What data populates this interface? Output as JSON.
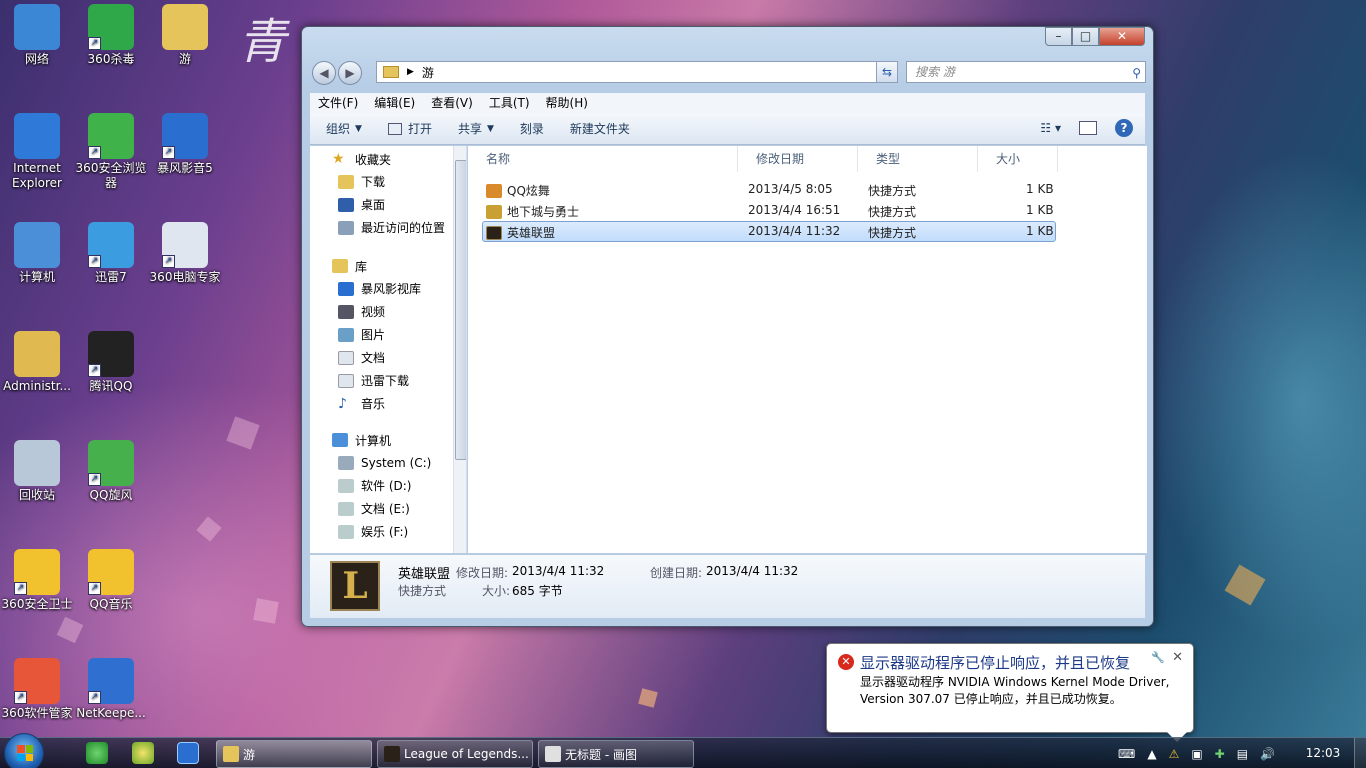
{
  "wallpaper": {
    "calligraphy": "青"
  },
  "desktop_icons": [
    {
      "label": "网络",
      "color": "#3b87d6"
    },
    {
      "label": "360杀毒",
      "color": "#2fa84a"
    },
    {
      "label": "游",
      "color": "#e6c45c"
    },
    {
      "label": "Internet Explorer",
      "color": "#2f7ad8"
    },
    {
      "label": "360安全浏览器",
      "color": "#3fb34a"
    },
    {
      "label": "暴风影音5",
      "color": "#2a6fd0"
    },
    {
      "label": "计算机",
      "color": "#4b8fd8"
    },
    {
      "label": "迅雷7",
      "color": "#3b9ce0"
    },
    {
      "label": "360电脑专家",
      "color": "#e0e6ef"
    },
    {
      "label": "Administr...",
      "color": "#e0b950"
    },
    {
      "label": "腾讯QQ",
      "color": "#222222"
    },
    {
      "label": "回收站",
      "color": "#b9c8d8"
    },
    {
      "label": "QQ旋风",
      "color": "#45b04c"
    },
    {
      "label": "360安全卫士",
      "color": "#f2c12e"
    },
    {
      "label": "QQ音乐",
      "color": "#f2c12e"
    },
    {
      "label": "360软件管家",
      "color": "#e8563a"
    },
    {
      "label": "NetKeepe...",
      "color": "#2f6fd0"
    }
  ],
  "window": {
    "caption_min": "–",
    "caption_max": "□",
    "caption_close": "✕",
    "back": "◀",
    "forward": "▶",
    "address": "游",
    "search_placeholder": "搜索 游",
    "menu": [
      "文件(F)",
      "编辑(E)",
      "查看(V)",
      "工具(T)",
      "帮助(H)"
    ],
    "toolbar": {
      "organize": "组织",
      "open": "打开",
      "share": "共享",
      "burn": "刻录",
      "new_folder": "新建文件夹",
      "help": "?"
    },
    "nav": {
      "favorites_header": "收藏夹",
      "favorites": [
        "下载",
        "桌面",
        "最近访问的位置"
      ],
      "library_header": "库",
      "libraries": [
        "暴风影视库",
        "视频",
        "图片",
        "文档",
        "迅雷下载",
        "音乐"
      ],
      "computer_header": "计算机",
      "drives": [
        "System (C:)",
        "软件 (D:)",
        "文档 (E:)",
        "娱乐 (F:)"
      ]
    },
    "columns": [
      "名称",
      "修改日期",
      "类型",
      "大小"
    ],
    "files": [
      {
        "name": "QQ炫舞",
        "date": "2013/4/5 8:05",
        "type": "快捷方式",
        "size": "1 KB",
        "color": "#d98a2a"
      },
      {
        "name": "地下城与勇士",
        "date": "2013/4/4 16:51",
        "type": "快捷方式",
        "size": "1 KB",
        "color": "#c9a033"
      },
      {
        "name": "英雄联盟",
        "date": "2013/4/4 11:32",
        "type": "快捷方式",
        "size": "1 KB",
        "color": "#2a2218"
      }
    ],
    "details": {
      "name": "英雄联盟",
      "modified_label": "修改日期:",
      "modified": "2013/4/4 11:32",
      "created_label": "创建日期:",
      "created": "2013/4/4 11:32",
      "type": "快捷方式",
      "size_label": "大小:",
      "size": "685 字节",
      "icon_letter": "L"
    }
  },
  "balloon": {
    "title": "显示器驱动程序已停止响应，并且已恢复",
    "message": "显示器驱动程序 NVIDIA Windows Kernel Mode Driver, Version 307.07  已停止响应，并且已成功恢复。",
    "close": "✕"
  },
  "taskbar": {
    "buttons": [
      {
        "label": "游",
        "color": "#e6c45c",
        "active": true
      },
      {
        "label": "League of Legends...",
        "color": "#2a2218",
        "active": false
      },
      {
        "label": "无标题 - 画图",
        "color": "#e0e0e0",
        "active": false
      }
    ],
    "clock": "12:03"
  }
}
